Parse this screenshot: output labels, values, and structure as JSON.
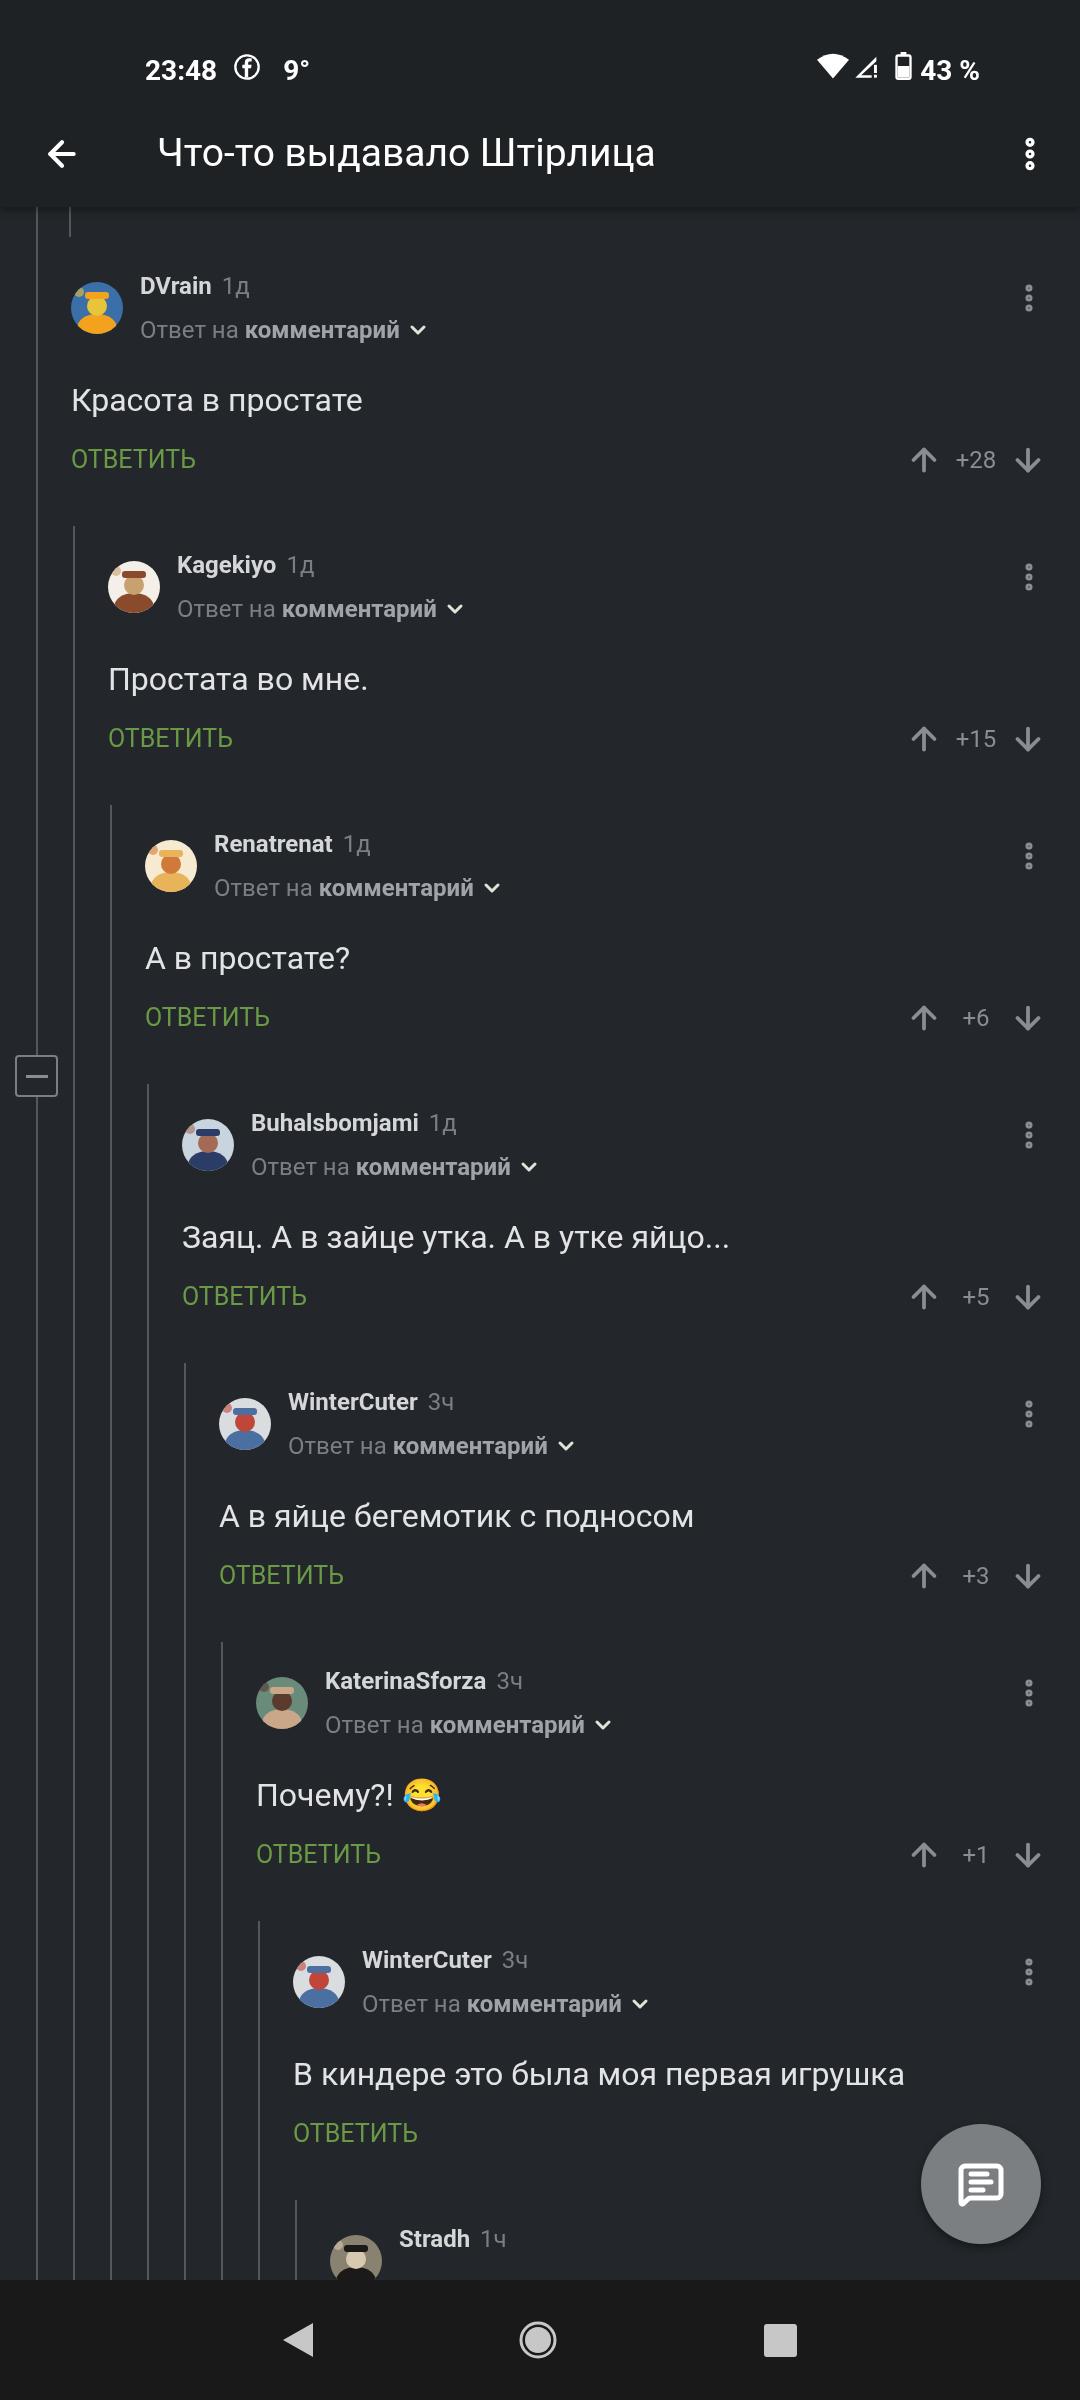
{
  "status_bar": {
    "time": "23:48",
    "temperature": "9°",
    "battery": "43 %"
  },
  "app_bar": {
    "title": "Что-то выдавало Штірлица"
  },
  "comments": [
    {
      "author": "DVrain",
      "time": "1д",
      "reply_line": "Ответ на **комментарий**",
      "body": "Красота в простате",
      "reply_label": "ОТВЕТИТЬ",
      "score": "+28",
      "children": [
        {
          "author": "Kagekiyo",
          "time": "1д",
          "reply_line": "Ответ на **комментарий**",
          "body": "Простата во мне.",
          "reply_label": "ОТВЕТИТЬ",
          "score": "+15",
          "children": [
            {
              "author": "Renatrenat",
              "time": "1д",
              "reply_line": "Ответ на **комментарий**",
              "body": "А в простате?",
              "reply_label": "ОТВЕТИТЬ",
              "score": "+6",
              "children": [
                {
                  "author": "Buhalsbomjami",
                  "time": "1д",
                  "reply_line": "Ответ на **комментарий**",
                  "body": "Заяц. А в зайце утка. А в утке яйцо...",
                  "reply_label": "ОТВЕТИТЬ",
                  "score": "+5",
                  "children": [
                    {
                      "author": "WinterCuter",
                      "time": "3ч",
                      "reply_line": "Ответ на **комментарий**",
                      "body": "А в яйце бегемотик с подносом",
                      "reply_label": "ОТВЕТИТЬ",
                      "score": "+3",
                      "children": [
                        {
                          "author": "KaterinaSforza",
                          "time": "3ч",
                          "reply_line": "Ответ на **комментарий**",
                          "body": "Почему?! 😂",
                          "reply_label": "ОТВЕТИТЬ",
                          "score": "+1",
                          "children": [
                            {
                              "author": "WinterCuter",
                              "time": "3ч",
                              "reply_line": "Ответ на **комментарий**",
                              "body": "В киндере это была моя первая игрушка",
                              "reply_label": "ОТВЕТИТЬ",
                              "children": [
                                {
                                  "author": "Stradh",
                                  "time": "1ч"
                                }
                              ]
                            }
                          ]
                        }
                      ]
                    }
                  ]
                }
              ]
            }
          ]
        }
      ]
    }
  ]
}
